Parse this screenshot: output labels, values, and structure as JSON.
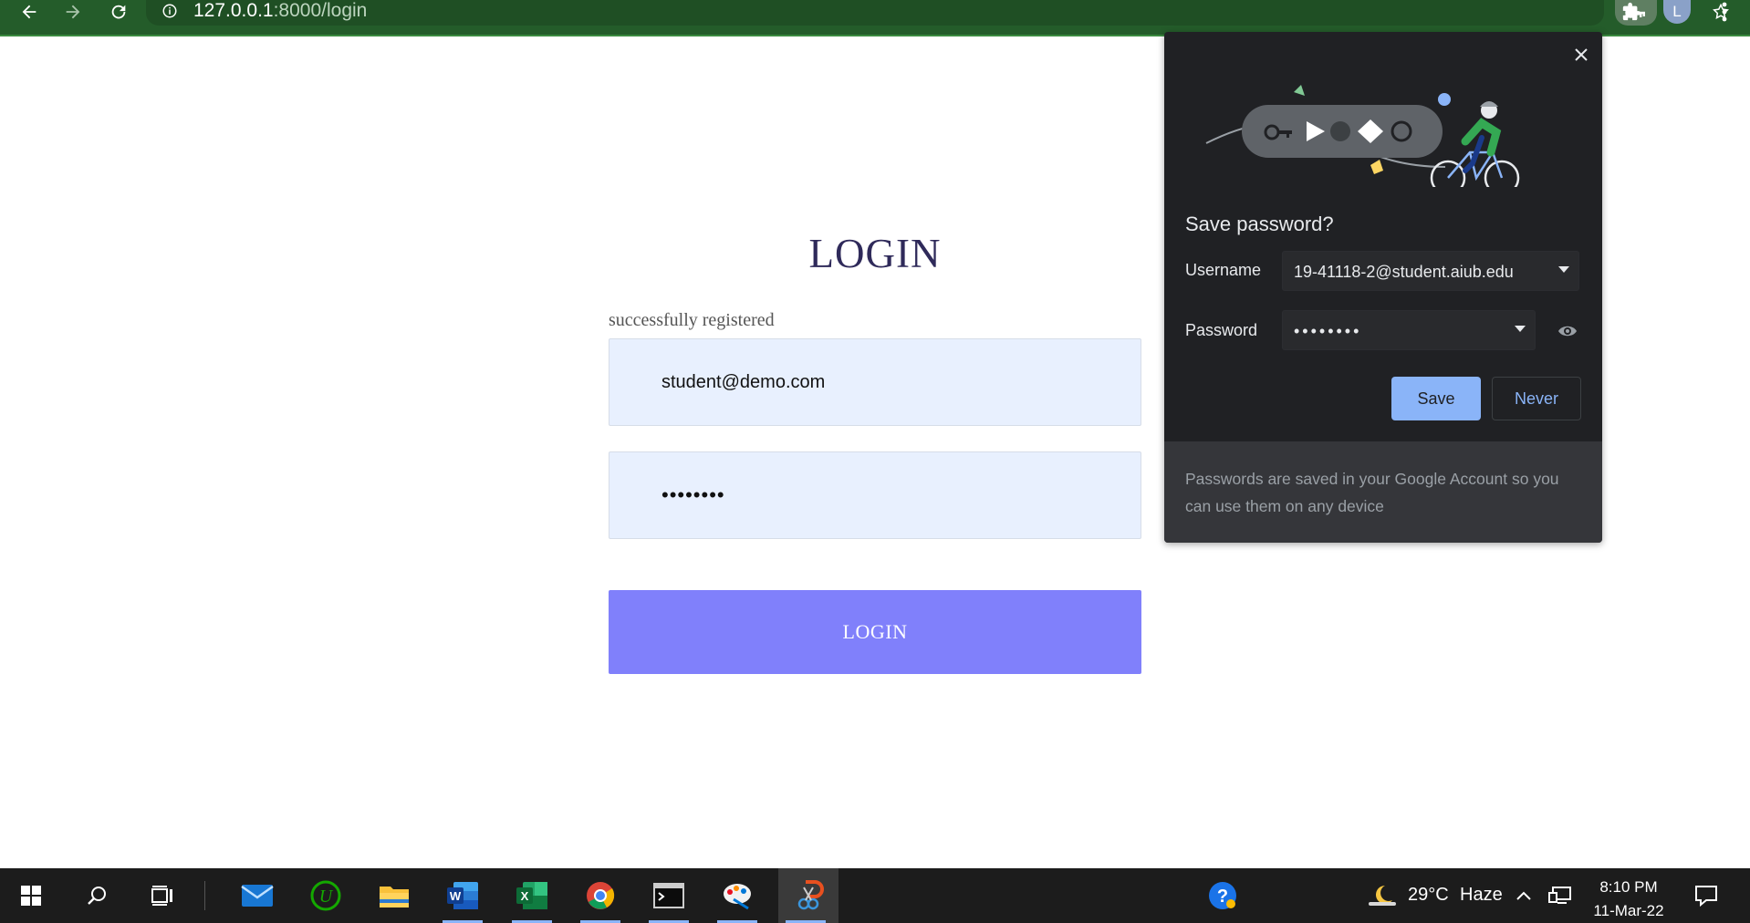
{
  "browser": {
    "url_host": "127.0.0.1",
    "url_path": ":8000/login",
    "profile_initial": "L"
  },
  "page": {
    "title": "LOGIN",
    "flash_message": "successfully registered",
    "email_value": "student@demo.com",
    "password_value": "••••••••",
    "submit_label": "LOGIN"
  },
  "save_password": {
    "title": "Save password?",
    "username_label": "Username",
    "username_value": "19-41118-2@student.aiub.edu",
    "password_label": "Password",
    "password_value": "••••••••",
    "save_label": "Save",
    "never_label": "Never",
    "footer_text": "Passwords are saved in your Google Account so you can use them on any device"
  },
  "taskbar": {
    "temperature": "29°C",
    "weather": "Haze",
    "time": "8:10 PM",
    "date": "11-Mar-22"
  },
  "colors": {
    "toolbar": "#245c2a",
    "login_button": "#8080fb",
    "field_bg": "#e8f0fe",
    "bubble_bg": "#202124",
    "accent_blue": "#8ab4f8"
  },
  "icons": [
    "back-icon",
    "forward-icon",
    "reload-icon",
    "info-icon",
    "key-icon",
    "share-icon",
    "star-icon",
    "extensions-icon",
    "menu-icon",
    "close-icon",
    "eye-icon",
    "windows-start-icon",
    "search-icon",
    "task-view-icon",
    "mail-icon",
    "upwork-icon",
    "file-explorer-icon",
    "word-icon",
    "excel-icon",
    "chrome-icon",
    "terminal-icon",
    "paint-icon",
    "snipping-icon",
    "help-icon",
    "weather-icon",
    "chevron-up-icon",
    "network-icon",
    "notification-icon"
  ]
}
